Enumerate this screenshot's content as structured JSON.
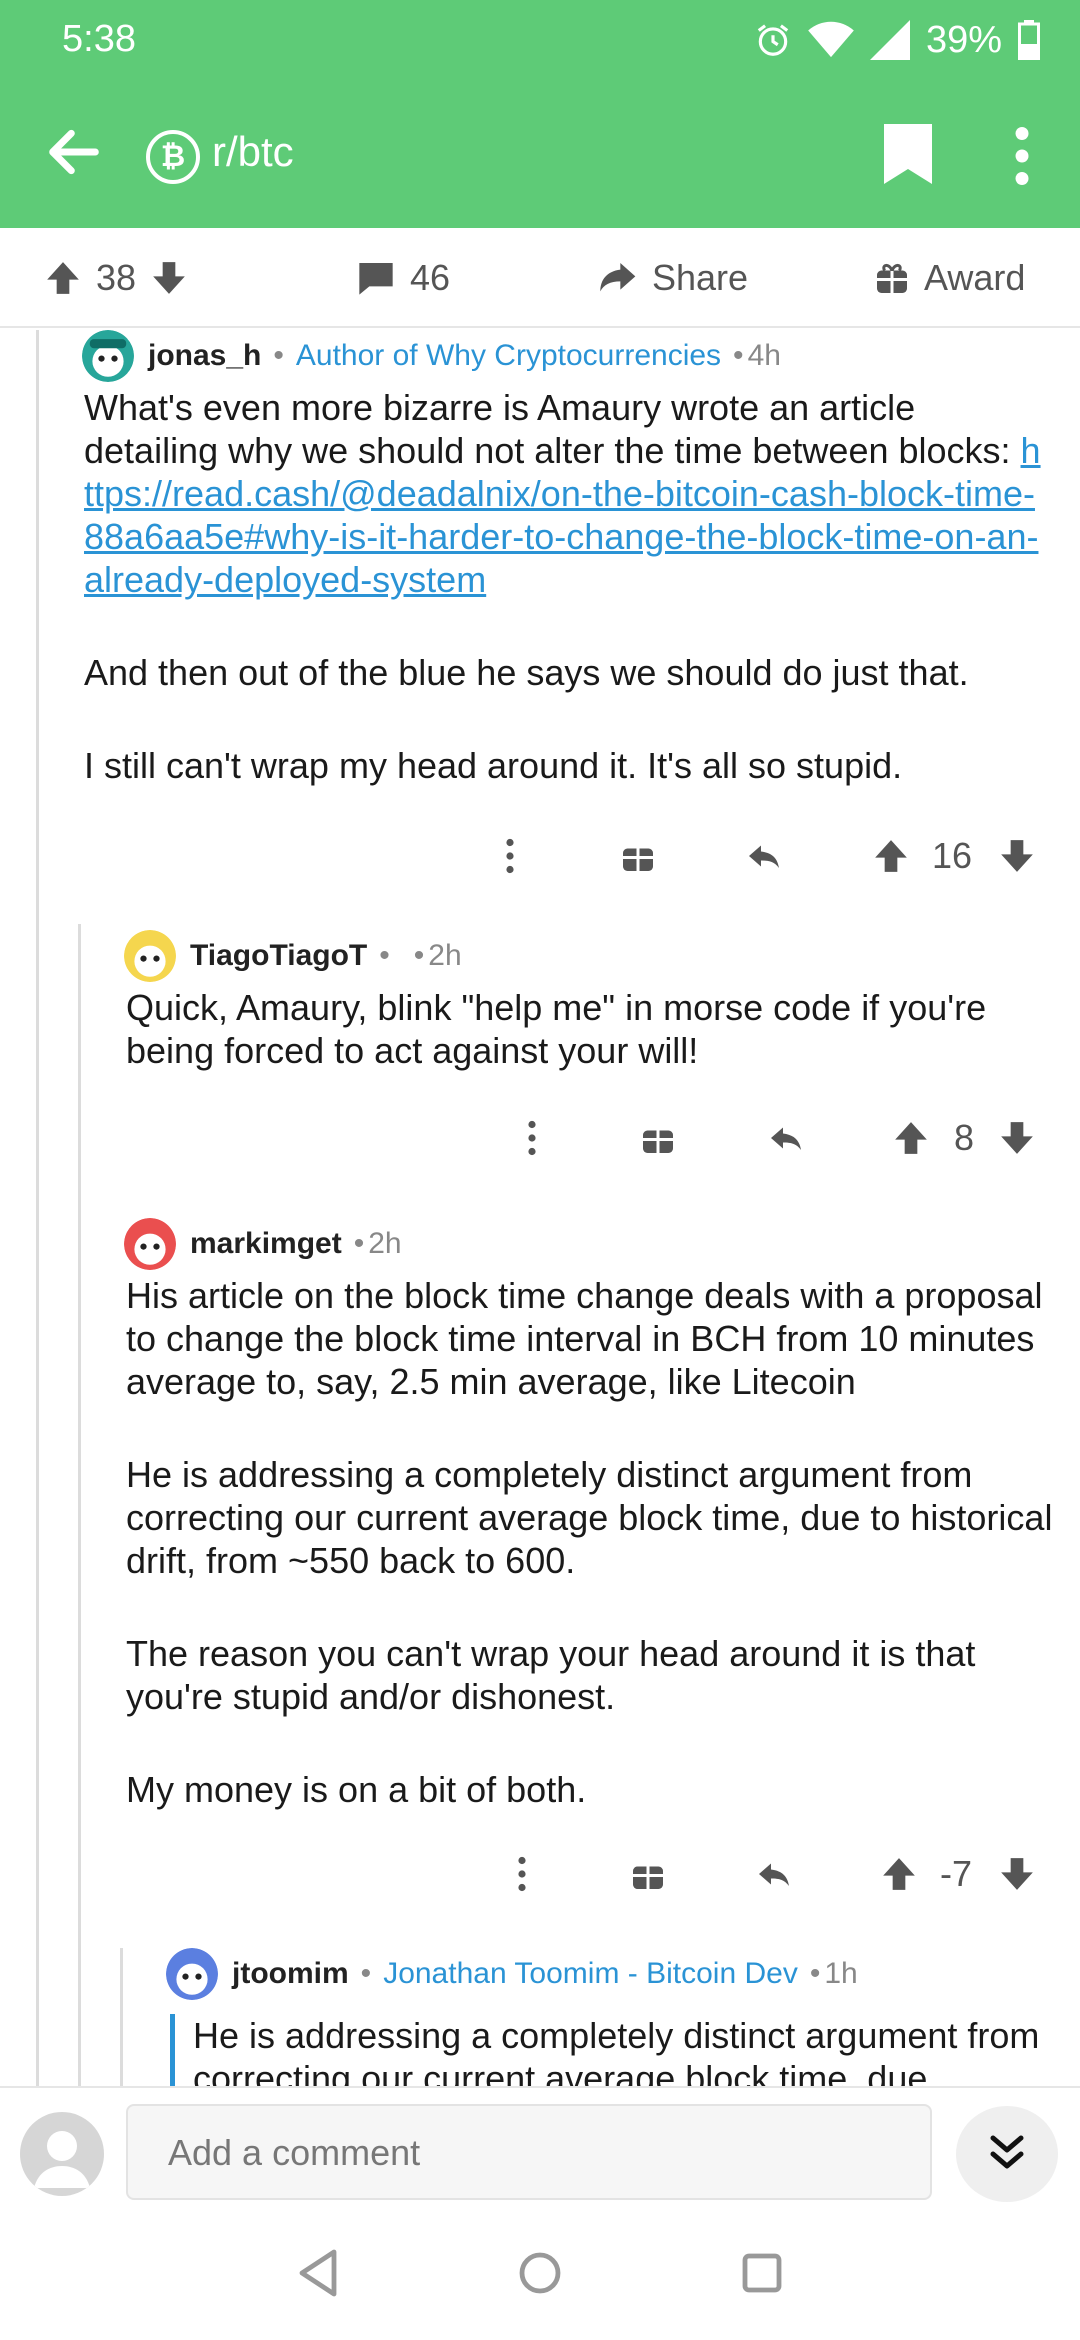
{
  "status": {
    "time": "5:38",
    "battery": "39%"
  },
  "header": {
    "subreddit": "r/btc",
    "sub_icon_glyph": "₿"
  },
  "post_actions": {
    "score": "38",
    "comments": "46",
    "share": "Share",
    "award": "Award"
  },
  "comments": [
    {
      "user": "jonas_h",
      "flair": "Author of Why Cryptocurrencies",
      "age": "4h",
      "text_1": "What's even more bizarre is Amaury wrote an article detailing why we should not alter the time between blocks: ",
      "link": "https://read.cash/@deadalnix/on-the-bitcoin-cash-block-time-88a6aa5e#why-is-it-harder-to-change-the-block-time-on-an-already-deployed-system",
      "text_2": "And then out of the blue he says we should do just that.",
      "text_3": "I still can't wrap my head around it. It's all so stupid.",
      "score": "16"
    },
    {
      "user": "TiagoTiagoT",
      "flair": "",
      "age": "2h",
      "text_1": "Quick, Amaury, blink \"help me\" in morse code if you're being forced to act against your will!",
      "score": "8"
    },
    {
      "user": "markimget",
      "age": "2h",
      "text_1": "His article on the block time change deals with a proposal to change the block time interval in BCH from 10 minutes average to, say, 2.5 min average, like Litecoin",
      "text_2": "He is addressing a completely distinct argument from correcting our current average block time, due to historical drift, from ~550 back to 600.",
      "text_3": "The reason you can't wrap your head around it is that you're stupid and/or dishonest.",
      "text_4": "My money is on a bit of both.",
      "score": "-7"
    },
    {
      "user": "jtoomim",
      "flair": "Jonathan Toomim - Bitcoin Dev",
      "age": "1h",
      "quote": "He is addressing a completely distinct argument from correcting our current average block time, due"
    }
  ],
  "comment_bar": {
    "placeholder": "Add a comment"
  },
  "colors": {
    "brand": "#5ecb77",
    "link": "#2a93d5"
  }
}
